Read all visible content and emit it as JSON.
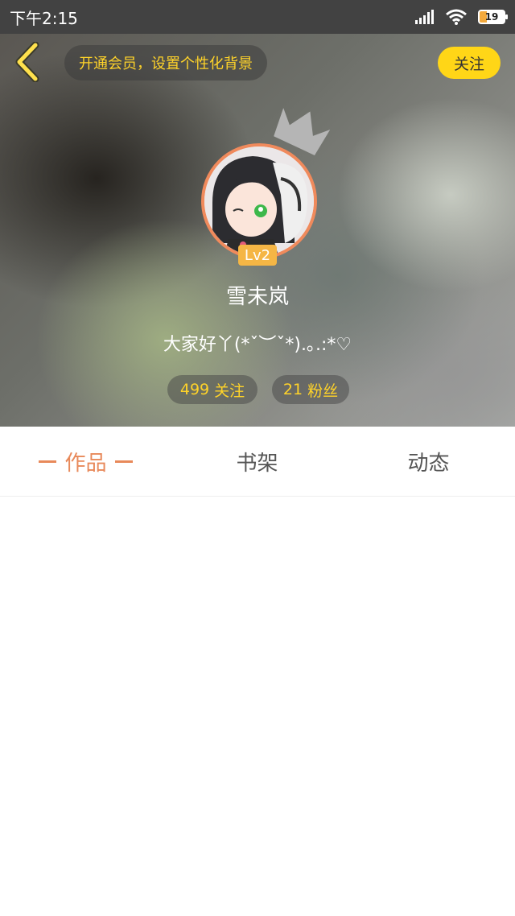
{
  "status_bar": {
    "time": "下午2:15",
    "battery": "19",
    "icons": [
      "signal-icon",
      "wifi-icon",
      "battery-icon"
    ]
  },
  "header": {
    "vip_prompt": "开通会员，设置个性化背景",
    "follow_label": "关注",
    "level": "Lv2",
    "username": "雪未岚",
    "bio": "大家好丫(*ˇ︶ˇ*).｡.:*♡",
    "following_count": "499",
    "following_label": "关注",
    "fans_count": "21",
    "fans_label": "粉丝"
  },
  "tabs": [
    {
      "label": "作品",
      "active": true
    },
    {
      "label": "书架",
      "active": false
    },
    {
      "label": "动态",
      "active": false
    }
  ],
  "colors": {
    "accent_yellow": "#ffd617",
    "active_tab": "#e8895a",
    "avatar_border": "#f08a5c",
    "level_badge": "#f5b645",
    "status_bar": "#424242"
  }
}
